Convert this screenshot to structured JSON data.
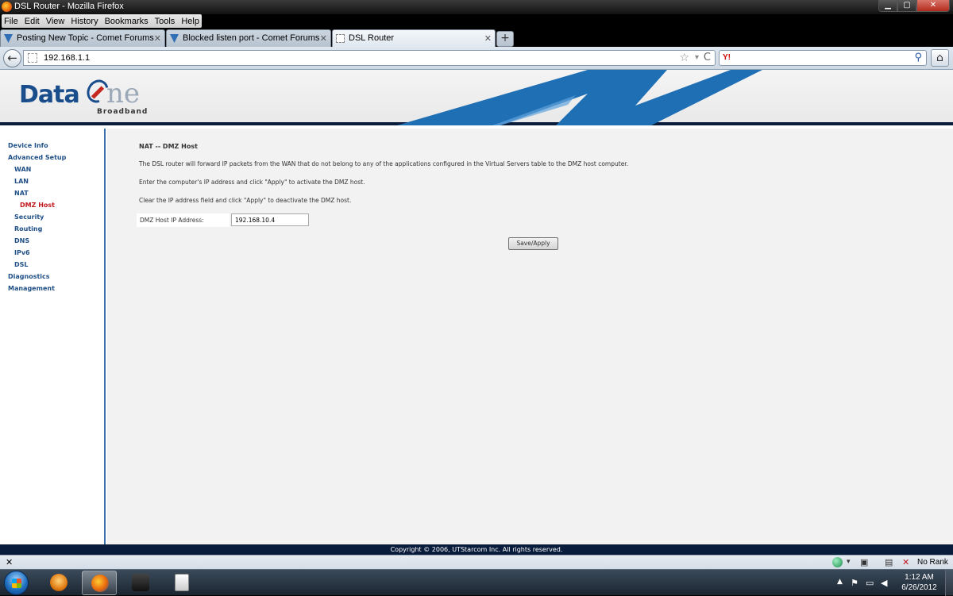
{
  "window": {
    "title": "DSL Router - Mozilla Firefox",
    "min": "▁",
    "max": "▢",
    "close": "✕"
  },
  "menu": [
    "File",
    "Edit",
    "View",
    "History",
    "Bookmarks",
    "Tools",
    "Help"
  ],
  "tabs": [
    {
      "label": "Posting New Topic - Comet Forums",
      "icon": "comet-forum-icon"
    },
    {
      "label": "Blocked listen port - Comet Forums",
      "icon": "comet-forum-icon"
    },
    {
      "label": "DSL Router",
      "icon": "blank-page-icon"
    }
  ],
  "tab_close": "✕",
  "new_tab": "+",
  "nav": {
    "back": "←",
    "url": "192.168.1.1",
    "star": "☆",
    "dropdown": "▾",
    "reload": "C",
    "search_engine": "Y!",
    "search_icon": "⚲",
    "home": "⌂"
  },
  "brand": {
    "data": "Data",
    "one": "ne",
    "broadband": "Broadband"
  },
  "sidebar": [
    {
      "label": "Device Info",
      "level": 0
    },
    {
      "label": "Advanced Setup",
      "level": 0
    },
    {
      "label": "WAN",
      "level": 1
    },
    {
      "label": "LAN",
      "level": 1
    },
    {
      "label": "NAT",
      "level": 1
    },
    {
      "label": "DMZ Host",
      "level": 2
    },
    {
      "label": "Security",
      "level": 1
    },
    {
      "label": "Routing",
      "level": 1
    },
    {
      "label": "DNS",
      "level": 1
    },
    {
      "label": "IPv6",
      "level": 1
    },
    {
      "label": "DSL",
      "level": 1
    },
    {
      "label": "Diagnostics",
      "level": 0
    },
    {
      "label": "Management",
      "level": 0
    }
  ],
  "content": {
    "heading": "NAT -- DMZ Host",
    "para1": "The DSL router will forward IP packets from the WAN that do not belong to any of the applications configured in the Virtual Servers table to the DMZ host computer.",
    "para2": "Enter the computer's IP address and click \"Apply\" to activate the DMZ host.",
    "para3": "Clear the IP address field and click \"Apply\" to deactivate the DMZ host.",
    "field_label": "DMZ Host IP Address:",
    "field_value": "192.168.10.4",
    "save_label": "Save/Apply"
  },
  "footer": "Copyright © 2006, UTStarcom Inc. All rights reserved.",
  "addonbar": {
    "close": "✕",
    "rank": "No Rank"
  },
  "taskbar": {
    "time": "1:12 AM",
    "date": "6/26/2012"
  },
  "colors": {
    "sidebar_link": "#1f4f86",
    "sidebar_active": "#c0181d",
    "header_bar": "#0a1c3c"
  }
}
